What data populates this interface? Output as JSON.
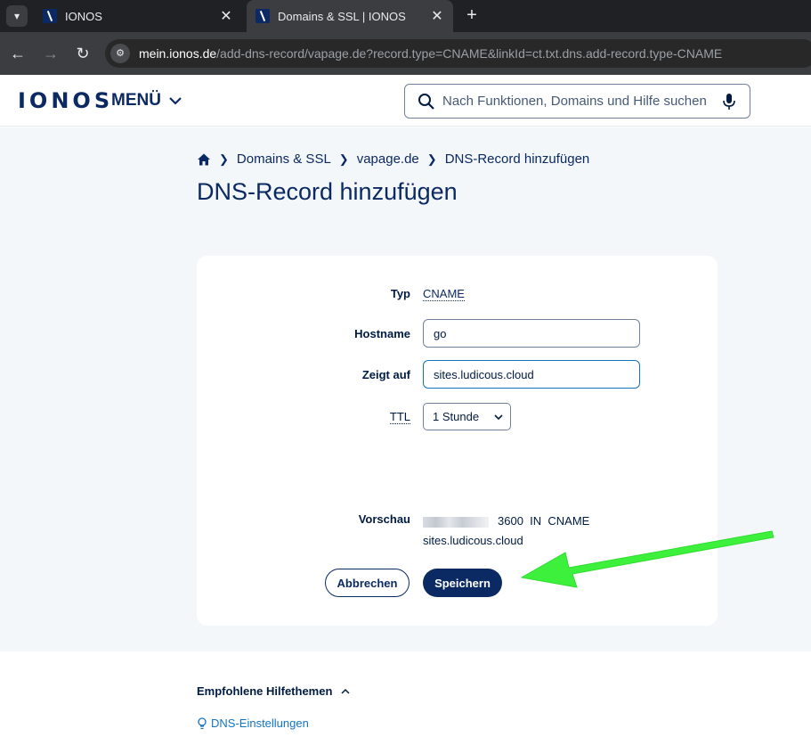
{
  "browser": {
    "tabs": [
      {
        "title": "IONOS",
        "active": false
      },
      {
        "title": "Domains & SSL | IONOS",
        "active": true
      }
    ],
    "url_host": "mein.ionos.de",
    "url_path": "/add-dns-record/vapage.de?record.type=CNAME&linkId=ct.txt.dns.add-record.type-CNAME"
  },
  "header": {
    "logo": "IONOS",
    "menu_label": "MENÜ",
    "search_placeholder": "Nach Funktionen, Domains und Hilfe suchen"
  },
  "breadcrumb": {
    "items": [
      "Domains & SSL",
      "vapage.de",
      "DNS-Record hinzufügen"
    ]
  },
  "page": {
    "title": "DNS-Record hinzufügen"
  },
  "form": {
    "type_label": "Typ",
    "type_value": "CNAME",
    "hostname_label": "Hostname",
    "hostname_value": "go",
    "points_to_label": "Zeigt auf",
    "points_to_value": "sites.ludicous.cloud",
    "ttl_label": "TTL",
    "ttl_value": "1 Stunde",
    "preview_label": "Vorschau",
    "preview_ttl": "3600",
    "preview_class": "IN",
    "preview_type": "CNAME",
    "preview_target": "sites.ludicous.cloud",
    "cancel_label": "Abbrechen",
    "save_label": "Speichern"
  },
  "help": {
    "title": "Empfohlene Hilfethemen",
    "links": [
      "DNS-Einstellungen"
    ]
  },
  "colors": {
    "brand": "#0b2a63",
    "background": "#f4f7fa",
    "annotation_arrow": "#3cf03c"
  }
}
